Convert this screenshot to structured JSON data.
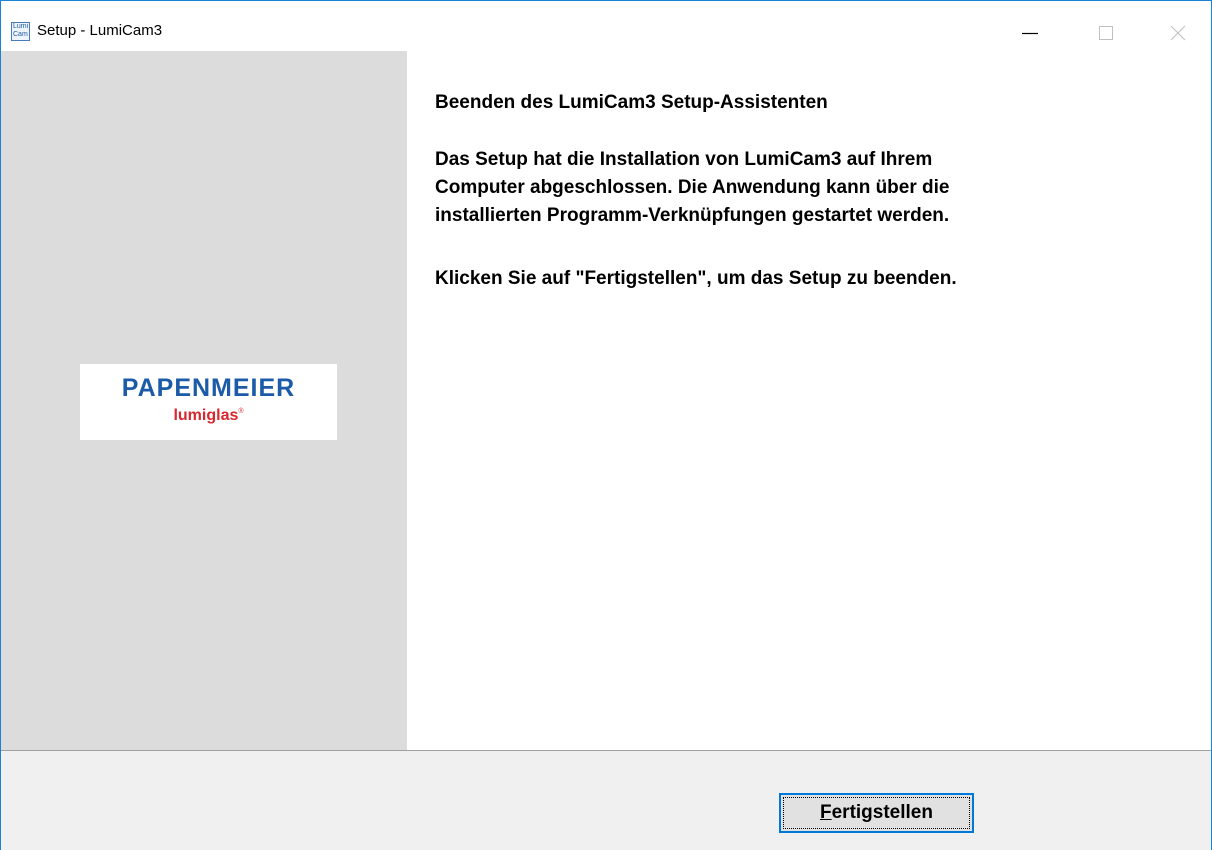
{
  "window": {
    "title": "Setup - LumiCam3",
    "icon": "lumicam-app-icon",
    "icon_text_line1": "Lumi",
    "icon_text_line2": "Cam",
    "controls": [
      "minimize-icon",
      "maximize-icon",
      "close-icon"
    ]
  },
  "sidebar": {
    "logo": {
      "brand": "PAPENMEIER",
      "sub": "lumiglas",
      "reg_mark": "®"
    },
    "background": "#dcdcdc"
  },
  "content": {
    "heading": "Beenden des LumiCam3 Setup-Assistenten",
    "paragraph1": [
      "Das Setup hat die Installation von LumiCam3 auf Ihrem",
      "Computer abgeschlossen. Die Anwendung kann über die",
      "installierten Programm-Verknüpfungen gestartet werden."
    ],
    "paragraph2": [
      "Klicken Sie auf \"Fertigstellen\", um das Setup zu beenden."
    ]
  },
  "footer": {
    "finish_button": {
      "mnemonic": "F",
      "rest": "ertigstellen"
    }
  },
  "colors": {
    "accent": "#0078d7",
    "brand_blue": "#1b5ba8",
    "brand_red": "#d8272d"
  }
}
